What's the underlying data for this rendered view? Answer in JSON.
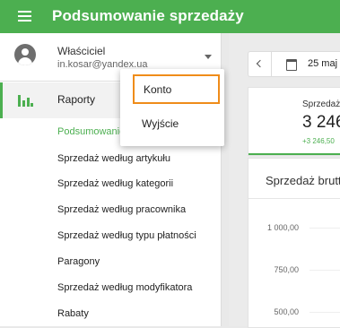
{
  "header": {
    "title": "Podsumowanie sprzedaży"
  },
  "user": {
    "name": "Właściciel",
    "email": "in.kosar@yandex.ua"
  },
  "sidebar": {
    "reports_label": "Raporty",
    "items": [
      {
        "label": "Podsumowanie sprzedaży",
        "active": true
      },
      {
        "label": "Sprzedaż według artykułu"
      },
      {
        "label": "Sprzedaż według kategorii"
      },
      {
        "label": "Sprzedaż według pracownika"
      },
      {
        "label": "Sprzedaż według typu płatności"
      },
      {
        "label": "Paragony"
      },
      {
        "label": "Sprzedaż według modyfikatora"
      },
      {
        "label": "Rabaty"
      }
    ]
  },
  "date_range": {
    "text": "25 maj"
  },
  "summary": {
    "label": "Sprzedaż",
    "value": "3 246",
    "delta": "+3 246,50"
  },
  "chart": {
    "title": "Sprzedaż brutto",
    "ticks": [
      "1 000,00",
      "750,00",
      "500,00"
    ]
  },
  "account_menu": {
    "items": [
      "Konto",
      "Wyjście"
    ]
  },
  "colors": {
    "primary": "#4caf50",
    "highlight": "#ef8c1a"
  },
  "icons": {
    "menu": "hamburger-icon",
    "avatar": "account-circle-icon",
    "reports": "bar-chart-icon",
    "calendar": "calendar-icon"
  }
}
